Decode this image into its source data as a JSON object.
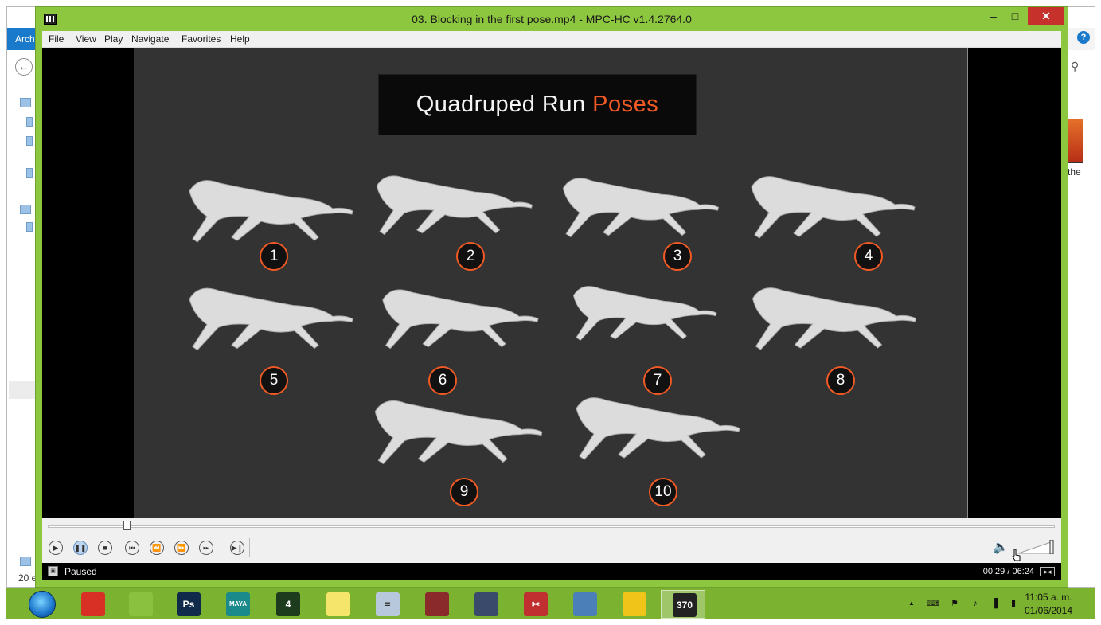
{
  "window": {
    "title": "03. Blocking in the first pose.mp4 - MPC-HC v1.4.2764.0",
    "minimize_glyph": "–",
    "maximize_glyph": "□",
    "close_glyph": "✕"
  },
  "menu": [
    {
      "label": "File"
    },
    {
      "label": "View"
    },
    {
      "label": "Play"
    },
    {
      "label": "Navigate"
    },
    {
      "label": "Favorites"
    },
    {
      "label": "Help"
    }
  ],
  "slide": {
    "title_main": "Quadruped Run",
    "title_accent": "Poses",
    "accent_color": "#f15a24",
    "poses": [
      {
        "number": "1"
      },
      {
        "number": "2"
      },
      {
        "number": "3"
      },
      {
        "number": "4"
      },
      {
        "number": "5"
      },
      {
        "number": "6"
      },
      {
        "number": "7"
      },
      {
        "number": "8"
      },
      {
        "number": "9"
      },
      {
        "number": "10"
      }
    ]
  },
  "playback": {
    "seek_position": 0.078,
    "volume_level": 1.0,
    "controls": [
      {
        "name": "play-button",
        "icon": "play-icon",
        "glyph": "▶"
      },
      {
        "name": "pause-button",
        "icon": "pause-icon",
        "glyph": "❚❚"
      },
      {
        "name": "stop-button",
        "icon": "stop-icon",
        "glyph": "■"
      },
      {
        "name": "previous-button",
        "icon": "skip-previous-icon",
        "glyph": "⏮"
      },
      {
        "name": "rewind-button",
        "icon": "rewind-icon",
        "glyph": "⏪"
      },
      {
        "name": "fast-forward-button",
        "icon": "fast-forward-icon",
        "glyph": "⏩"
      },
      {
        "name": "next-button",
        "icon": "skip-next-icon",
        "glyph": "⏭"
      },
      {
        "name": "frame-step-button",
        "icon": "frame-step-icon",
        "glyph": "▶❙"
      }
    ]
  },
  "status": {
    "state": "Paused",
    "time": "00:29 / 06:24"
  },
  "background_window": {
    "file_tab": "Archi",
    "file_label": "the",
    "count_text": "20 e"
  },
  "taskbar": {
    "items": [
      {
        "name": "taskbar-chrome",
        "icon": "chrome-icon",
        "color": "#d93025",
        "glyph": ""
      },
      {
        "name": "taskbar-app-green",
        "icon": "green-app-icon",
        "color": "#8ac240",
        "glyph": ""
      },
      {
        "name": "taskbar-photoshop",
        "icon": "photoshop-icon",
        "color": "#0f2a4a",
        "glyph": "Ps"
      },
      {
        "name": "taskbar-maya",
        "icon": "maya-icon",
        "color": "#1a8a8a",
        "glyph": "MAYA"
      },
      {
        "name": "taskbar-app-dark",
        "icon": "dark-app-icon",
        "color": "#1d3b1d",
        "glyph": "4"
      },
      {
        "name": "taskbar-sticky-notes",
        "icon": "sticky-notes-icon",
        "color": "#f5e56b",
        "glyph": ""
      },
      {
        "name": "taskbar-calculator",
        "icon": "calculator-icon",
        "color": "#b7c8dc",
        "glyph": "="
      },
      {
        "name": "taskbar-game-1",
        "icon": "game-icon",
        "color": "#8b2a2a",
        "glyph": ""
      },
      {
        "name": "taskbar-game-2",
        "icon": "game-icon",
        "color": "#3a4a6a",
        "glyph": ""
      },
      {
        "name": "taskbar-snipping-tool",
        "icon": "scissors-icon",
        "color": "#c03030",
        "glyph": "✂"
      },
      {
        "name": "taskbar-photo-viewer",
        "icon": "photo-viewer-icon",
        "color": "#4a7fb8",
        "glyph": ""
      },
      {
        "name": "taskbar-file-explorer",
        "icon": "folder-icon",
        "color": "#f0c419",
        "glyph": ""
      },
      {
        "name": "taskbar-mpc-hc",
        "icon": "mpc-hc-icon",
        "color": "#222222",
        "glyph": "370",
        "active": true
      }
    ],
    "tray_icons": [
      {
        "name": "tray-show-hidden-icon",
        "glyph": "▲"
      },
      {
        "name": "tray-keyboard-icon",
        "glyph": "⌨"
      },
      {
        "name": "tray-flag-icon",
        "glyph": "⚑"
      },
      {
        "name": "tray-speaker-icon",
        "glyph": "♪"
      },
      {
        "name": "tray-network-icon",
        "glyph": "▐"
      },
      {
        "name": "tray-power-icon",
        "glyph": "▮"
      }
    ],
    "clock_time": "11:05 a. m.",
    "clock_date": "01/06/2014"
  }
}
